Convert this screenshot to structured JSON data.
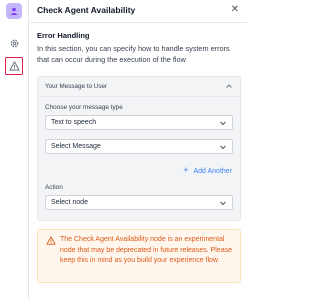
{
  "header": {
    "title": "Check Agent Availability",
    "close_icon": "close-icon",
    "close_glyph": "✕"
  },
  "rail": {
    "items": [
      "node-avatar-icon",
      "gear-icon",
      "warning-icon"
    ],
    "active": "warning-icon",
    "active_color": "#e11d48"
  },
  "error_handling": {
    "title": "Error Handling",
    "description": "In this section, you can specify how to handle system errors that can occur during the execution of the flow"
  },
  "message_card": {
    "title": "Your Message to User",
    "message_type_label": "Choose your message type",
    "message_type_value": "Text to speech",
    "message_value": "Select Message",
    "add_another_label": "Add Another",
    "action_label": "Action",
    "action_value": "Select node"
  },
  "warning": {
    "text": "The Check Agent Availability node is an experimental node that may be deprecated in future releases. Please keep this in mind as you build your experience flow.",
    "text_color": "#dc5a1a",
    "background": "#fff7ed"
  },
  "colors": {
    "accent": "#3b82f6",
    "border": "#e5e7eb"
  }
}
